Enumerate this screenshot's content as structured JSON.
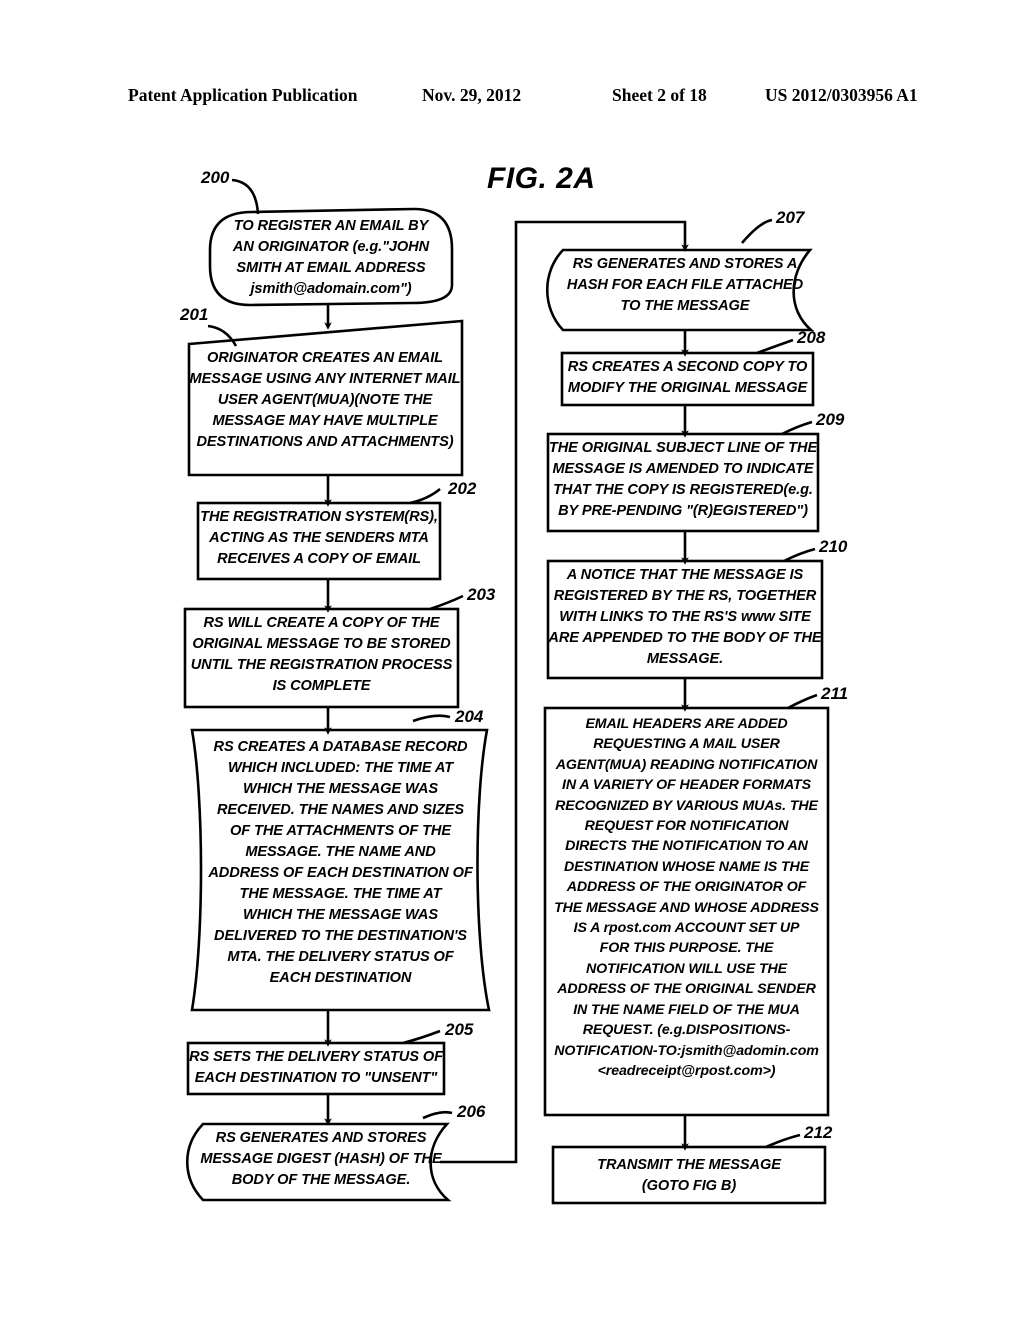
{
  "header": {
    "publication": "Patent Application Publication",
    "date": "Nov. 29, 2012",
    "sheet": "Sheet 2 of 18",
    "number": "US 2012/0303956 A1"
  },
  "figure": {
    "title": "FIG. 2A"
  },
  "nodes": [
    {
      "id": "200",
      "ref": "200",
      "shape": "terminator",
      "text": "TO REGISTER AN EMAIL BY\nAN ORIGINATOR (e.g.\"JOHN\nSMITH AT EMAIL ADDRESS\njsmith@adomain.com\")"
    },
    {
      "id": "201",
      "ref": "201",
      "shape": "skewed-box",
      "text": "ORIGINATOR CREATES AN EMAIL\nMESSAGE USING ANY INTERNET MAIL\nUSER AGENT(MUA)(NOTE THE\nMESSAGE MAY HAVE MULTIPLE\nDESTINATIONS AND ATTACHMENTS)"
    },
    {
      "id": "202",
      "ref": "202",
      "shape": "box",
      "text": "THE REGISTRATION SYSTEM(RS),\nACTING AS THE SENDERS MTA\nRECEIVES A COPY OF EMAIL"
    },
    {
      "id": "203",
      "ref": "203",
      "shape": "box",
      "text": "RS WILL CREATE A COPY OF THE\nORIGINAL MESSAGE TO BE STORED\nUNTIL THE REGISTRATION PROCESS\nIS COMPLETE"
    },
    {
      "id": "204",
      "ref": "204",
      "shape": "bowed-box",
      "text": "RS CREATES A DATABASE RECORD\nWHICH INCLUDED: THE TIME AT\nWHICH THE MESSAGE WAS\nRECEIVED.  THE NAMES AND SIZES\nOF THE ATTACHMENTS OF THE\nMESSAGE.  THE NAME AND\nADDRESS OF EACH DESTINATION OF\nTHE MESSAGE.  THE TIME AT\nWHICH THE MESSAGE WAS\nDELIVERED TO THE DESTINATION'S\nMTA.  THE DELIVERY STATUS OF\nEACH DESTINATION"
    },
    {
      "id": "205",
      "ref": "205",
      "shape": "box",
      "text": "RS SETS THE DELIVERY STATUS OF\nEACH DESTINATION TO \"UNSENT\""
    },
    {
      "id": "206",
      "ref": "206",
      "shape": "tape",
      "text": "RS GENERATES AND STORES\nMESSAGE DIGEST (HASH) OF THE\nBODY OF THE MESSAGE."
    },
    {
      "id": "207",
      "ref": "207",
      "shape": "tape",
      "text": "RS GENERATES AND STORES A\nHASH FOR EACH FILE ATTACHED\nTO THE MESSAGE"
    },
    {
      "id": "208",
      "ref": "208",
      "shape": "box",
      "text": "RS CREATES A SECOND COPY TO\nMODIFY THE ORIGINAL MESSAGE"
    },
    {
      "id": "209",
      "ref": "209",
      "shape": "box",
      "text": "THE ORIGINAL SUBJECT LINE OF THE\nMESSAGE IS AMENDED TO INDICATE\nTHAT THE COPY IS REGISTERED(e.g.\nBY PRE-PENDING \"(R)EGISTERED\")"
    },
    {
      "id": "210",
      "ref": "210",
      "shape": "box",
      "text": "A NOTICE THAT THE MESSAGE IS\nREGISTERED BY THE RS, TOGETHER\nWITH LINKS TO THE RS'S www SITE\nARE APPENDED TO THE BODY OF THE\nMESSAGE."
    },
    {
      "id": "211",
      "ref": "211",
      "shape": "box",
      "text": "EMAIL HEADERS ARE ADDED\nREQUESTING A MAIL USER\nAGENT(MUA) READING NOTIFICATION\nIN A VARIETY OF HEADER FORMATS\nRECOGNIZED BY VARIOUS MUAs. THE\nREQUEST FOR NOTIFICATION\nDIRECTS THE NOTIFICATION TO AN\nDESTINATION WHOSE NAME IS THE\nADDRESS OF THE  ORIGINATOR OF\nTHE MESSAGE AND WHOSE ADDRESS\nIS A rpost.com ACCOUNT SET UP\nFOR THIS PURPOSE. THE\nNOTIFICATION WILL USE THE\nADDRESS OF THE ORIGINAL SENDER\nIN THE NAME FIELD OF THE MUA\nREQUEST. (e.g.DISPOSITIONS-\nNOTIFICATION-TO:jsmith@adomin.com\n<readreceipt@rpost.com>)"
    },
    {
      "id": "212",
      "ref": "212",
      "shape": "box",
      "text": "TRANSMIT THE MESSAGE\n(GOTO  FIG B)"
    }
  ]
}
